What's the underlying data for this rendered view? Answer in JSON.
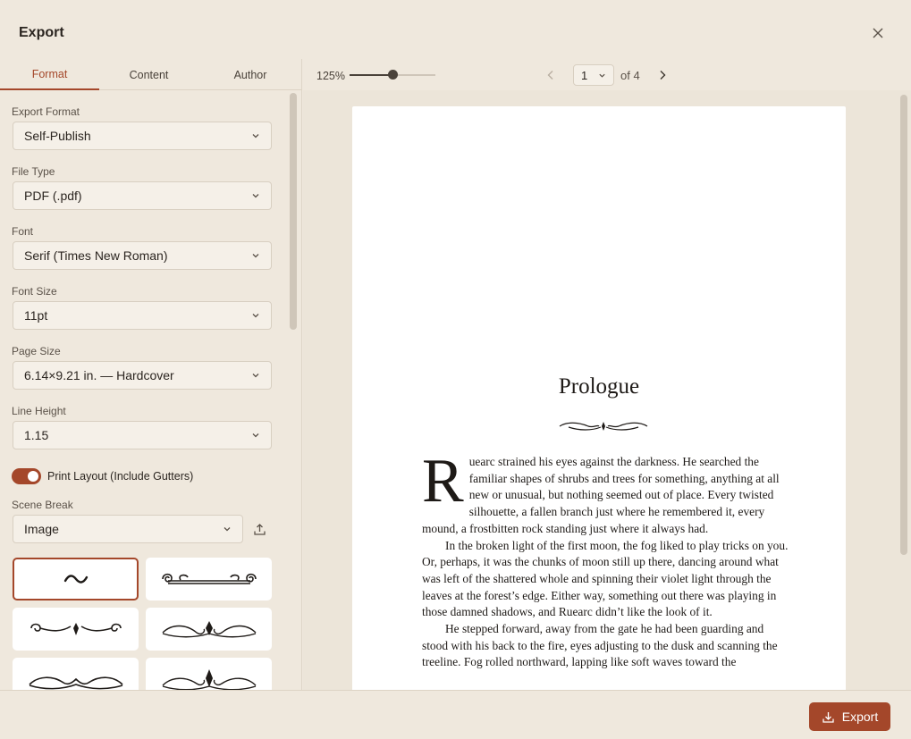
{
  "dialog": {
    "title": "Export"
  },
  "tabs": [
    "Format",
    "Content",
    "Author"
  ],
  "fields": [
    {
      "label": "Export Format",
      "value": "Self-Publish"
    },
    {
      "label": "File Type",
      "value": "PDF (.pdf)"
    },
    {
      "label": "Font",
      "value": "Serif (Times New Roman)"
    },
    {
      "label": "Font Size",
      "value": "11pt"
    },
    {
      "label": "Page Size",
      "value": "6.14×9.21 in. — Hardcover"
    },
    {
      "label": "Line Height",
      "value": "1.15"
    }
  ],
  "print_layout": {
    "label": "Print Layout (Include Gutters)",
    "on": true
  },
  "scene_break": {
    "label": "Scene Break",
    "value": "Image"
  },
  "preview": {
    "zoom_label": "125%",
    "zoom_fraction": 0.5,
    "page": "1",
    "of_label": "of 4",
    "chapter_title": "Prologue",
    "drop_cap": "R",
    "paragraphs": [
      "uearc strained his eyes against the darkness. He searched the familiar shapes of shrubs and trees for something, anything at all new or unusual, but nothing seemed out of place. Every twisted silhouette, a fallen branch just where he remembered it, every mound, a frostbitten rock standing just where it always had.",
      "In the broken light of the first moon, the fog liked to play tricks on you. Or, perhaps, it was the chunks of moon still up there, dancing around what was left of the shattered whole and spinning their violet light through the leaves at the forest’s edge. Either way, something out there was playing in those damned shadows, and Ruearc didn’t like the look of it.",
      "He stepped forward, away from the gate he had been guarding and stood with his back to the fire, eyes adjusting to the dusk and scanning the treeline. Fog rolled northward, lapping like soft waves toward the"
    ]
  },
  "footer": {
    "export_label": "Export"
  },
  "colors": {
    "accent": "#a4472a",
    "background": "#efe8dd"
  }
}
